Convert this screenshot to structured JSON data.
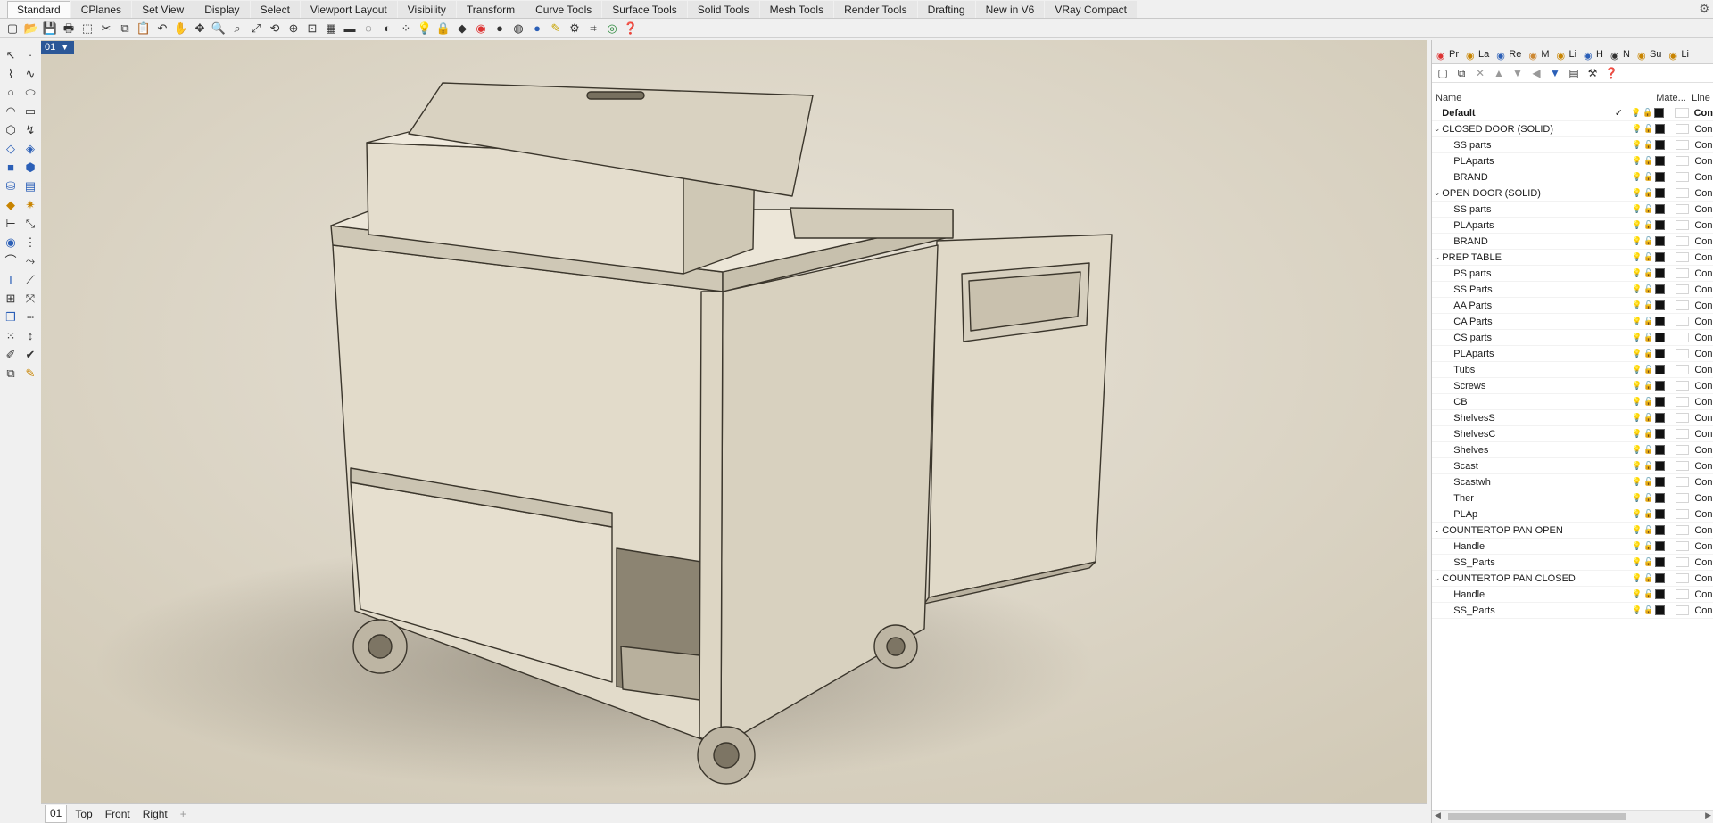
{
  "menu_tabs": [
    "Standard",
    "CPlanes",
    "Set View",
    "Display",
    "Select",
    "Viewport Layout",
    "Visibility",
    "Transform",
    "Curve Tools",
    "Surface Tools",
    "Solid Tools",
    "Mesh Tools",
    "Render Tools",
    "Drafting",
    "New in V6",
    "VRay Compact"
  ],
  "active_tab": "Standard",
  "viewport": {
    "label": "01",
    "tabs": [
      "01",
      "Top",
      "Front",
      "Right"
    ],
    "active": "01",
    "add": "+"
  },
  "panel": {
    "tabs": [
      "Pr",
      "La",
      "Re",
      "M",
      "Li",
      "H",
      "N",
      "Su",
      "Li"
    ],
    "columns": {
      "name": "Name",
      "material": "Mate...",
      "linetype": "Line"
    },
    "current_mark": "✓",
    "layers": [
      {
        "name": "Default",
        "level": 0,
        "current": true,
        "line": "Con",
        "bulb": "off"
      },
      {
        "name": "CLOSED DOOR (SOLID)",
        "level": 0,
        "expanded": true,
        "line": "Con",
        "bulb": "off"
      },
      {
        "name": "SS parts",
        "level": 1,
        "line": "Con",
        "bulb": "off"
      },
      {
        "name": "PLAparts",
        "level": 1,
        "line": "Con",
        "bulb": "off"
      },
      {
        "name": "BRAND",
        "level": 1,
        "line": "Con",
        "bulb": "off"
      },
      {
        "name": "OPEN DOOR (SOLID)",
        "level": 0,
        "expanded": true,
        "line": "Con",
        "bulb": "on"
      },
      {
        "name": "SS parts",
        "level": 1,
        "line": "Con",
        "bulb": "on"
      },
      {
        "name": "PLAparts",
        "level": 1,
        "line": "Con",
        "bulb": "on"
      },
      {
        "name": "BRAND",
        "level": 1,
        "line": "Con",
        "bulb": "on"
      },
      {
        "name": "PREP TABLE",
        "level": 0,
        "expanded": true,
        "line": "Con",
        "bulb": "on"
      },
      {
        "name": "PS parts",
        "level": 1,
        "line": "Con",
        "bulb": "on"
      },
      {
        "name": "SS Parts",
        "level": 1,
        "line": "Con",
        "bulb": "on"
      },
      {
        "name": "AA Parts",
        "level": 1,
        "line": "Con",
        "bulb": "on"
      },
      {
        "name": "CA Parts",
        "level": 1,
        "line": "Con",
        "bulb": "on"
      },
      {
        "name": "CS parts",
        "level": 1,
        "line": "Con",
        "bulb": "on"
      },
      {
        "name": "PLAparts",
        "level": 1,
        "line": "Con",
        "bulb": "on"
      },
      {
        "name": "Tubs",
        "level": 1,
        "line": "Con",
        "bulb": "on"
      },
      {
        "name": "Screws",
        "level": 1,
        "line": "Con",
        "bulb": "on"
      },
      {
        "name": "CB",
        "level": 1,
        "line": "Con",
        "bulb": "on"
      },
      {
        "name": "ShelvesS",
        "level": 1,
        "line": "Con",
        "bulb": "on"
      },
      {
        "name": "ShelvesC",
        "level": 1,
        "line": "Con",
        "bulb": "on"
      },
      {
        "name": "Shelves",
        "level": 1,
        "line": "Con",
        "bulb": "on"
      },
      {
        "name": "Scast",
        "level": 1,
        "line": "Con",
        "bulb": "on"
      },
      {
        "name": "Scastwh",
        "level": 1,
        "line": "Con",
        "bulb": "on"
      },
      {
        "name": "Ther",
        "level": 1,
        "line": "Con",
        "bulb": "on"
      },
      {
        "name": "PLAp",
        "level": 1,
        "line": "Con",
        "bulb": "on"
      },
      {
        "name": "COUNTERTOP PAN OPEN",
        "level": 0,
        "expanded": true,
        "line": "Con",
        "bulb": "on"
      },
      {
        "name": "Handle",
        "level": 1,
        "line": "Con",
        "bulb": "on"
      },
      {
        "name": "SS_Parts",
        "level": 1,
        "line": "Con",
        "bulb": "on"
      },
      {
        "name": "COUNTERTOP PAN CLOSED",
        "level": 0,
        "expanded": true,
        "line": "Con",
        "bulb": "off"
      },
      {
        "name": "Handle",
        "level": 1,
        "line": "Con",
        "bulb": "off"
      },
      {
        "name": "SS_Parts",
        "level": 1,
        "line": "Con",
        "bulb": "off"
      }
    ]
  }
}
